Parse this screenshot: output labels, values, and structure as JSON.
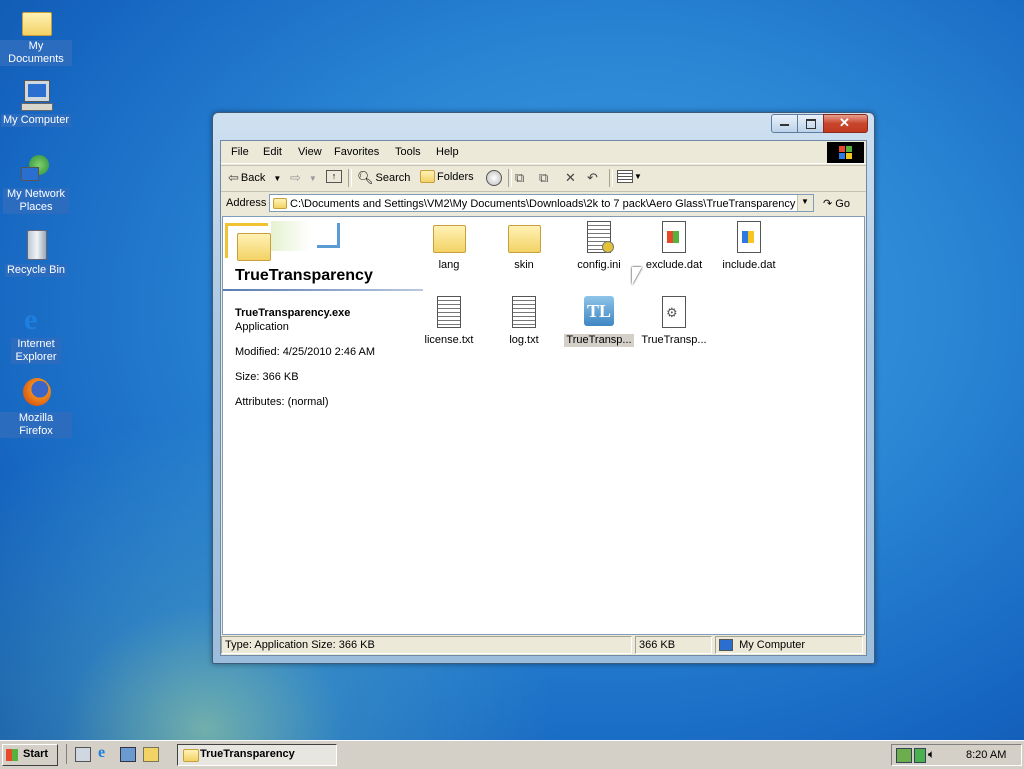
{
  "desktop": {
    "icons": [
      {
        "label": "My Documents",
        "icon": "folder-documents-icon"
      },
      {
        "label": "My Computer",
        "icon": "computer-icon"
      },
      {
        "label": "My Network Places",
        "icon": "network-icon"
      },
      {
        "label": "Recycle Bin",
        "icon": "recycle-bin-icon"
      },
      {
        "label": "Internet Explorer",
        "icon": "ie-icon"
      },
      {
        "label": "Mozilla Firefox",
        "icon": "firefox-icon"
      }
    ]
  },
  "window": {
    "title": "TrueTransparency",
    "menu": [
      "File",
      "Edit",
      "View",
      "Favorites",
      "Tools",
      "Help"
    ],
    "toolbar": {
      "back": "Back",
      "search": "Search",
      "folders": "Folders"
    },
    "address": {
      "label": "Address",
      "value": "C:\\Documents and Settings\\VM2\\My Documents\\Downloads\\2k to 7 pack\\Aero Glass\\TrueTransparency",
      "go": "Go"
    },
    "info_panel": {
      "folder_title": "TrueTransparency",
      "file_name": "TrueTransparency.exe",
      "file_type": "Application",
      "modified": "Modified: 4/25/2010 2:46 AM",
      "size": "Size: 366 KB",
      "attributes": "Attributes: (normal)"
    },
    "files": [
      {
        "name": "lang",
        "type": "folder"
      },
      {
        "name": "skin",
        "type": "folder"
      },
      {
        "name": "config.ini",
        "type": "ini"
      },
      {
        "name": "exclude.dat",
        "type": "dat"
      },
      {
        "name": "include.dat",
        "type": "dat"
      },
      {
        "name": "license.txt",
        "type": "txt"
      },
      {
        "name": "log.txt",
        "type": "txt"
      },
      {
        "name": "TrueTransp...",
        "type": "exe",
        "selected": true
      },
      {
        "name": "TrueTransp...",
        "type": "config"
      }
    ],
    "status": {
      "left": "Type: Application Size: 366 KB",
      "size": "366 KB",
      "zone": "My Computer"
    }
  },
  "taskbar": {
    "start": "Start",
    "task": "TrueTransparency",
    "clock": "8:20 AM"
  }
}
